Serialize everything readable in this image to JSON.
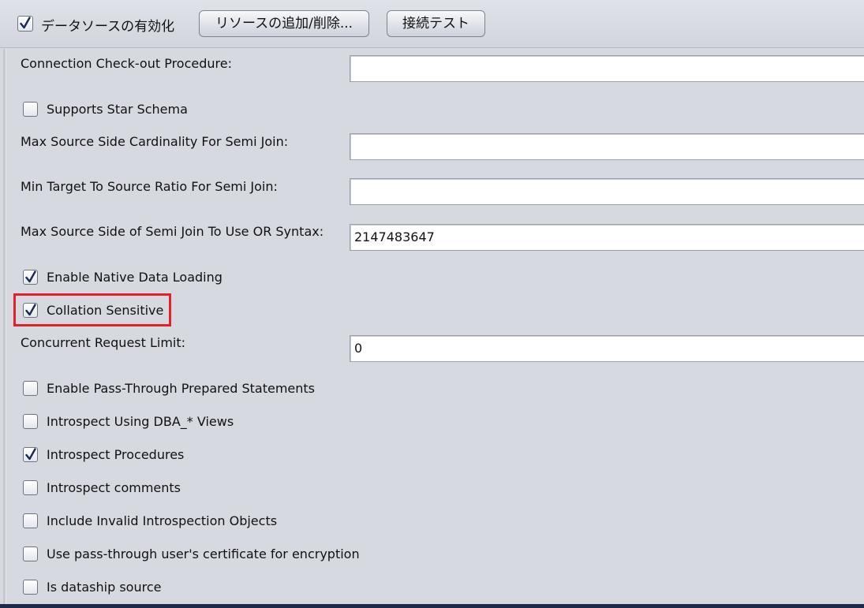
{
  "toolbar": {
    "enable_datasource_label": "データソースの有効化",
    "enable_datasource_checked": true,
    "add_remove_resources_label": "リソースの追加/削除...",
    "connection_test_label": "接続テスト"
  },
  "fields": {
    "checkout_procedure": {
      "label": "Connection Check-out Procedure:",
      "value": ""
    },
    "max_source_cardinality": {
      "label": "Max Source Side Cardinality For Semi Join:",
      "value": ""
    },
    "min_target_ratio": {
      "label": "Min Target To Source Ratio For Semi Join:",
      "value": ""
    },
    "max_semi_join_or": {
      "label": "Max Source Side of Semi Join To Use OR Syntax:",
      "value": "2147483647"
    },
    "concurrent_limit": {
      "label": "Concurrent Request Limit:",
      "value": "0"
    }
  },
  "checks": {
    "star_schema": {
      "label": "Supports Star Schema",
      "checked": false
    },
    "native_loading": {
      "label": "Enable Native Data Loading",
      "checked": true
    },
    "collation": {
      "label": "Collation Sensitive",
      "checked": true
    },
    "pass_through": {
      "label": "Enable Pass-Through Prepared Statements",
      "checked": false
    },
    "dba_views": {
      "label": "Introspect Using DBA_* Views",
      "checked": false
    },
    "procedures": {
      "label": "Introspect Procedures",
      "checked": true
    },
    "comments": {
      "label": "Introspect comments",
      "checked": false
    },
    "invalid_objects": {
      "label": "Include Invalid Introspection Objects",
      "checked": false
    },
    "certificate": {
      "label": "Use pass-through user's certificate for encryption",
      "checked": false
    },
    "dataship": {
      "label": "Is dataship source",
      "checked": false
    }
  },
  "colors": {
    "background": "#d6d9e0",
    "highlight": "#e3212b",
    "checkmark": "#1b2a55"
  }
}
